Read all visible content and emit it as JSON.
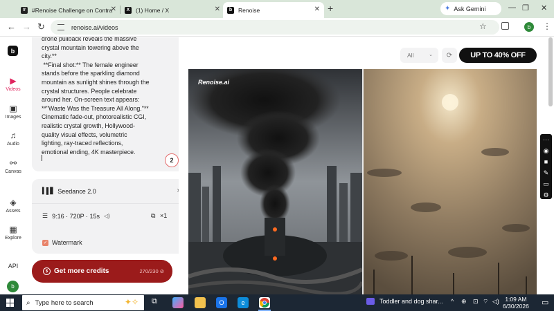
{
  "browser": {
    "tabs": [
      {
        "title": "#Renoise Challenge on Contra",
        "active": false
      },
      {
        "title": "(1) Home / X",
        "active": false
      },
      {
        "title": "Renoise",
        "active": true
      }
    ],
    "ask_gemini": "Ask Gemini",
    "url": "renoise.ai/videos"
  },
  "sidebar": {
    "logo": "b",
    "items": [
      {
        "label": "Videos",
        "icon": "video-icon",
        "active": true
      },
      {
        "label": "Images",
        "icon": "image-icon",
        "active": false
      },
      {
        "label": "Audio",
        "icon": "audio-icon",
        "active": false
      },
      {
        "label": "Canvas",
        "icon": "canvas-icon",
        "active": false
      },
      {
        "label": "Assets",
        "icon": "assets-icon",
        "active": false
      },
      {
        "label": "Explore",
        "icon": "explore-icon",
        "active": false
      },
      {
        "label": "API",
        "icon": "",
        "active": false
      }
    ],
    "avatar": "b"
  },
  "composer": {
    "prompt_text": "drone pullback reveals the massive\ncrystal mountain towering above the\ncity.**\n **Final shot:** The female engineer\nstands before the sparkling diamond\nmountain as sunlight shines through the\ncrystal structures. People celebrate\naround her. On-screen text appears:\n**\"Waste Was the Treasure All Along.\"**\nCinematic fade-out, photorealistic CGI,\nrealistic crystal growth, Hollywood-\nquality visual effects, volumetric\nlighting, ray-traced reflections,\nemotional ending, 4K masterpiece.",
    "badge": "2",
    "model": "Seedance 2.0",
    "params": "9:16 · 720P · 15s",
    "count": "×1",
    "watermark_label": "Watermark",
    "watermark_checked": true,
    "credits_button": "Get more credits",
    "credits_count": "270/230"
  },
  "main": {
    "filter": "All",
    "promo": "UP TO 40% OFF",
    "video_watermark": "Renoise.ai"
  },
  "taskbar": {
    "search_placeholder": "Type here to search",
    "media_title": "Toddler and dog shar...",
    "time": "1:09 AM",
    "date": "6/30/2026"
  }
}
